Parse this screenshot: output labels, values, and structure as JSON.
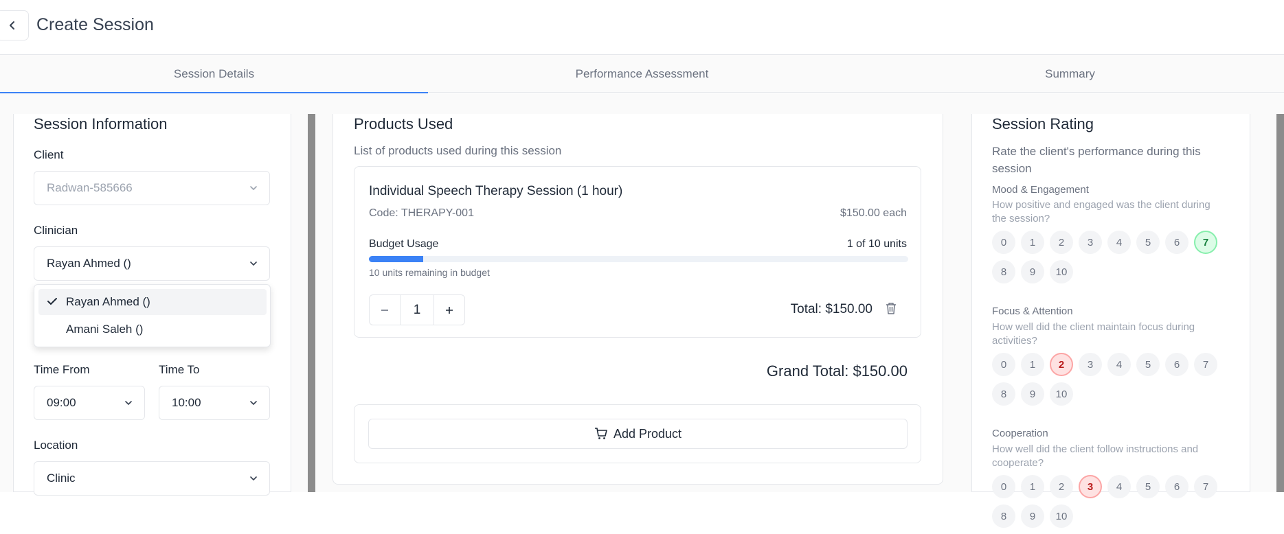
{
  "header": {
    "title": "Create Session"
  },
  "tabs": [
    {
      "label": "Session Details",
      "active": true
    },
    {
      "label": "Performance Assessment",
      "active": false
    },
    {
      "label": "Summary",
      "active": false
    }
  ],
  "session_info": {
    "title": "Session Information",
    "client_label": "Client",
    "client_value": "Radwan-585666",
    "clinician_label": "Clinician",
    "clinician_value": "Rayan Ahmed ()",
    "clinician_options": [
      "Rayan Ahmed ()",
      "Amani Saleh ()"
    ],
    "time_from_label": "Time From",
    "time_from_value": "09:00",
    "time_to_label": "Time To",
    "time_to_value": "10:00",
    "location_label": "Location",
    "location_value": "Clinic"
  },
  "products": {
    "title": "Products Used",
    "subtitle": "List of products used during this session",
    "item": {
      "name": "Individual Speech Therapy Session (1 hour)",
      "code": "Code: THERAPY-001",
      "price": "$150.00 each",
      "budget_label": "Budget Usage",
      "budget_units": "1 of 10 units",
      "budget_fraction": 0.1,
      "remaining": "10 units remaining in budget",
      "quantity": "1",
      "total": "Total: $150.00"
    },
    "grand_total": "Grand Total: $150.00",
    "add_label": "Add Product"
  },
  "rating": {
    "title": "Session Rating",
    "subtitle": "Rate the client's performance during this session",
    "questions": [
      {
        "title": "Mood & Engagement",
        "desc": "How positive and engaged was the client during the session?",
        "selected": 7,
        "color": "green"
      },
      {
        "title": "Focus & Attention",
        "desc": "How well did the client maintain focus during activities?",
        "selected": 2,
        "color": "red"
      },
      {
        "title": "Cooperation",
        "desc": "How well did the client follow instructions and cooperate?",
        "selected": 3,
        "color": "red"
      }
    ],
    "scale": [
      "0",
      "1",
      "2",
      "3",
      "4",
      "5",
      "6",
      "7",
      "8",
      "9",
      "10"
    ]
  },
  "colors": {
    "accent": "#3b82f6",
    "green": "#86efac",
    "red": "#fca5a5"
  },
  "icons": [
    "chevron-left-icon",
    "chevron-down-icon",
    "check-icon",
    "minus-icon",
    "plus-icon",
    "trash-icon",
    "cart-icon"
  ]
}
